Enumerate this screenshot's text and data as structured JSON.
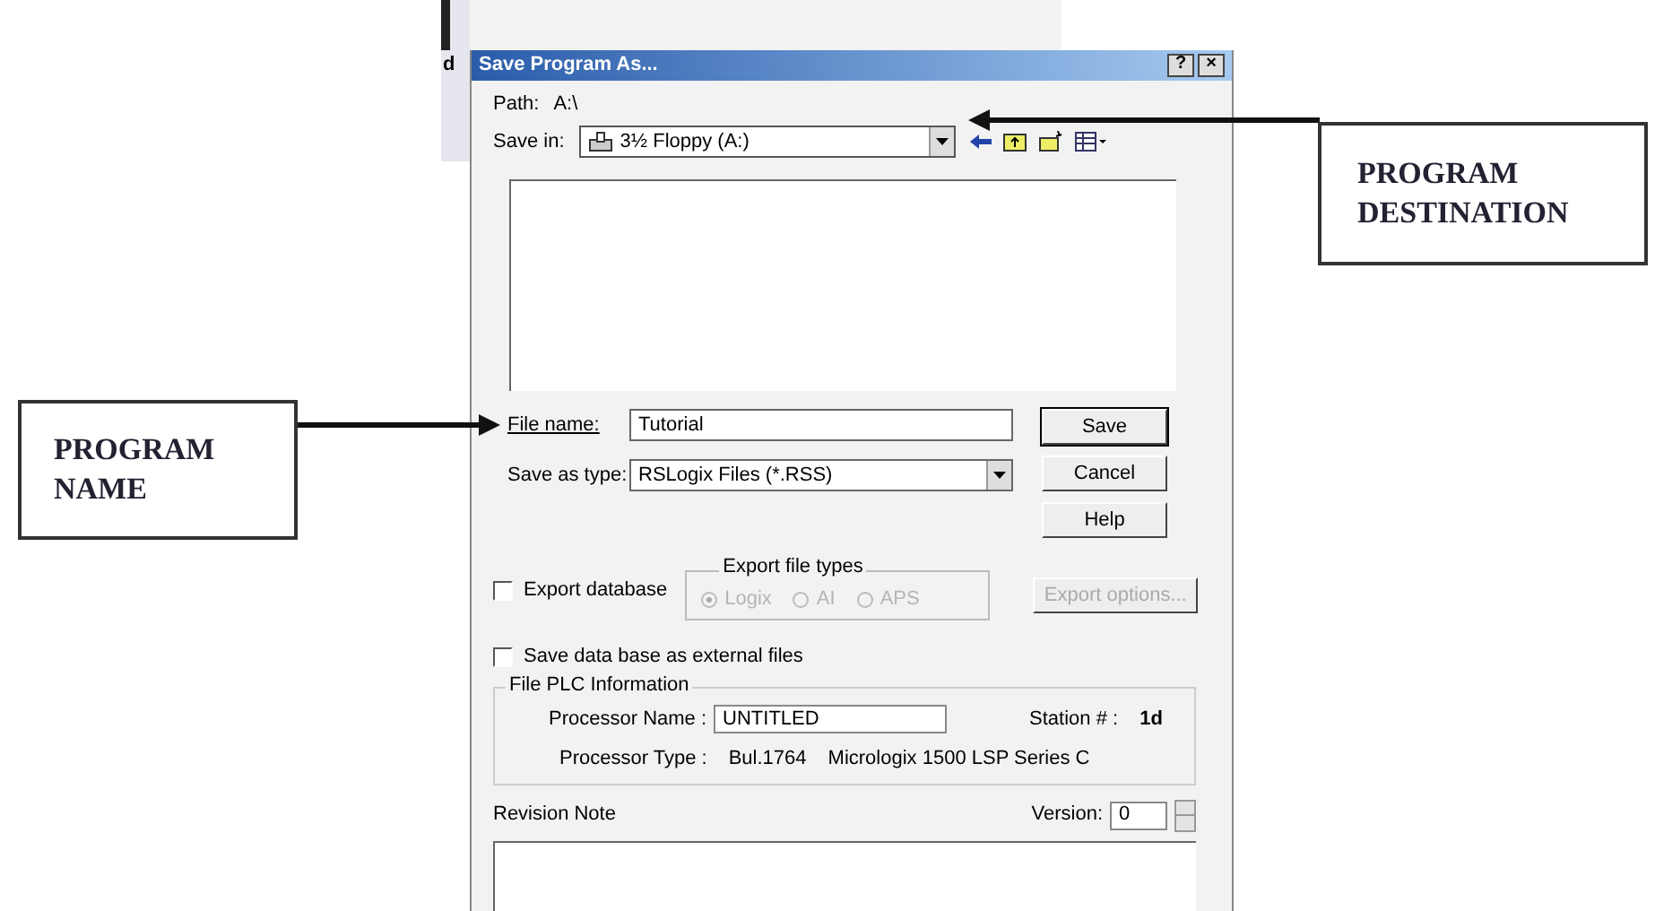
{
  "background_window": {
    "text": "d"
  },
  "dialog": {
    "title": "Save Program As...",
    "help_button": "?",
    "close_button": "×",
    "path": {
      "label": "Path:",
      "value": "A:\\"
    },
    "save_in": {
      "label": "Save in:",
      "value": "3½ Floppy (A:)"
    },
    "file_name": {
      "label": "File name:",
      "value": "Tutorial"
    },
    "save_as_type": {
      "label": "Save as type:",
      "value": "RSLogix Files (*.RSS)"
    },
    "buttons": [
      {
        "label": "Save",
        "default": true
      },
      {
        "label": "Cancel",
        "default": false
      },
      {
        "label": "Help",
        "default": false
      }
    ],
    "export_database": {
      "label": "Export database",
      "checked": false
    },
    "export_file_types": {
      "title": "Export file types",
      "options": [
        {
          "label": "Logix",
          "selected": true,
          "disabled": true
        },
        {
          "label": "AI",
          "selected": false,
          "disabled": true
        },
        {
          "label": "APS",
          "selected": false,
          "disabled": true
        }
      ]
    },
    "export_options": {
      "label": "Export options...",
      "disabled": true
    },
    "save_external": {
      "label": "Save data base as external files",
      "checked": false
    },
    "plc_info": {
      "title": "File PLC Information",
      "processor_name_label": "Processor Name :",
      "processor_name": "UNTITLED",
      "station_label": "Station # :",
      "station": "1d",
      "processor_type_label": "Processor Type :",
      "processor_type": "Bul.1764",
      "processor_model": "Micrologix 1500 LSP Series C"
    },
    "revision_note": {
      "label": "Revision Note"
    },
    "version": {
      "label": "Version:",
      "value": "0"
    }
  },
  "annotations": [
    {
      "kind": "destination",
      "text": "PROGRAM DESTINATION"
    },
    {
      "kind": "name",
      "text": "PROGRAM NAME"
    }
  ]
}
